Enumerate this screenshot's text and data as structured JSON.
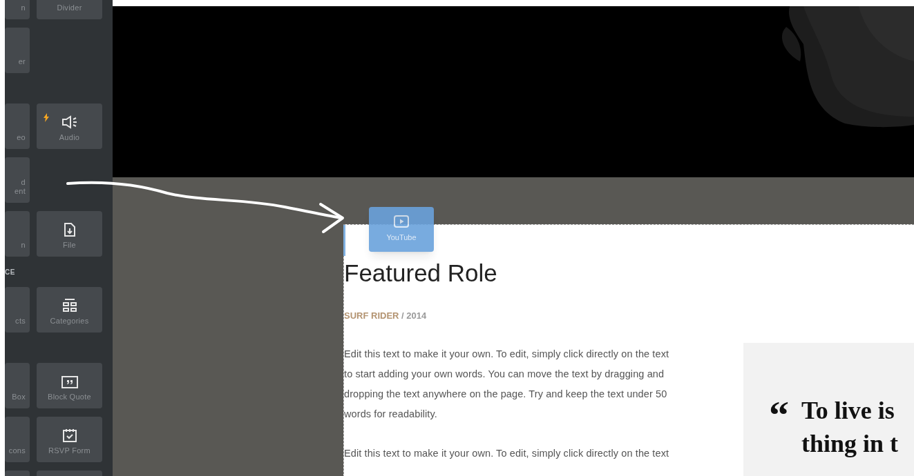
{
  "sidebar": {
    "items": [
      {
        "kind": "row",
        "tiles": [
          {
            "label": "n",
            "kind": "plain",
            "premium": false
          },
          {
            "label": "Divider",
            "kind": "plain",
            "premium": false
          }
        ]
      },
      {
        "kind": "row",
        "tiles": [
          {
            "label": "er",
            "kind": "plain",
            "premium": false
          }
        ]
      },
      {
        "kind": "section"
      },
      {
        "kind": "row",
        "tiles": [
          {
            "label": "eo",
            "kind": "plain",
            "premium": false
          },
          {
            "label": "Audio",
            "kind": "audio",
            "premium": true
          }
        ]
      },
      {
        "kind": "row",
        "tiles": [
          {
            "label": "d\nent",
            "kind": "plain",
            "premium": false
          }
        ]
      },
      {
        "kind": "row",
        "tiles": [
          {
            "label": "n",
            "kind": "plain",
            "premium": false
          },
          {
            "label": "File",
            "kind": "file",
            "premium": false
          }
        ]
      },
      {
        "kind": "section",
        "label": "CE"
      },
      {
        "kind": "row",
        "tiles": [
          {
            "label": "cts",
            "kind": "plain",
            "premium": false
          },
          {
            "label": "Categories",
            "kind": "categories",
            "premium": false
          }
        ]
      },
      {
        "kind": "section"
      },
      {
        "kind": "row",
        "tiles": [
          {
            "label": "Box",
            "kind": "plain",
            "premium": false
          },
          {
            "label": "Block Quote",
            "kind": "quote",
            "premium": false
          }
        ]
      },
      {
        "kind": "row",
        "tiles": [
          {
            "label": "cons",
            "kind": "plain",
            "premium": false
          },
          {
            "label": "RSVP Form",
            "kind": "rsvp",
            "premium": false
          }
        ]
      },
      {
        "kind": "row",
        "tiles": [
          {
            "kind": "plain",
            "premium": false
          },
          {
            "kind": "plain",
            "premium": false
          }
        ]
      }
    ]
  },
  "drag_tile": {
    "label": "YouTube"
  },
  "content": {
    "heading": "Featured Role",
    "meta": {
      "title": "SURF RIDER",
      "year": " / 2014"
    },
    "paragraphs": [
      "Edit this text to make it your own. To edit, simply click directly on the text to start adding your own words. You can move the text by dragging and dropping the text anywhere on the page. Try and keep the text under 50 words for readability.",
      "Edit this text to make it your own. To edit, simply click directly on the text"
    ],
    "quote": {
      "mark": "“",
      "lines": [
        "To live is",
        "thing in t"
      ]
    }
  }
}
